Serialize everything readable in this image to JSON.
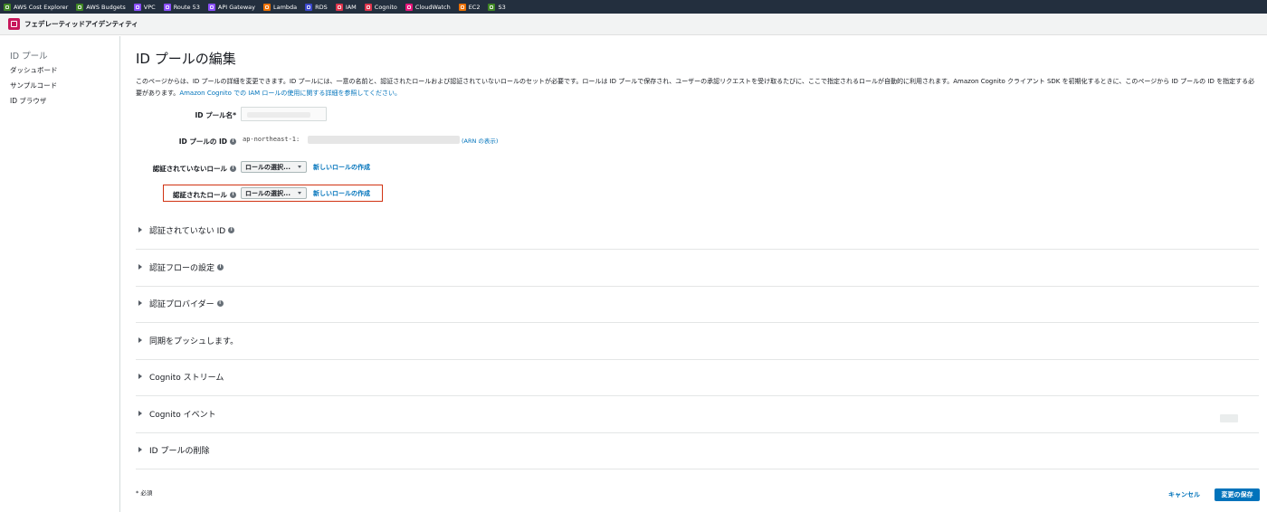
{
  "favorites": [
    {
      "label": "AWS Cost Explorer",
      "icon": "cost-explorer-icon",
      "color": "#3f8624"
    },
    {
      "label": "AWS Budgets",
      "icon": "budgets-icon",
      "color": "#3f8624"
    },
    {
      "label": "VPC",
      "icon": "vpc-icon",
      "color": "#8c4fff"
    },
    {
      "label": "Route 53",
      "icon": "route53-icon",
      "color": "#8c4fff"
    },
    {
      "label": "API Gateway",
      "icon": "api-gateway-icon",
      "color": "#8c4fff"
    },
    {
      "label": "Lambda",
      "icon": "lambda-icon",
      "color": "#ed7100"
    },
    {
      "label": "RDS",
      "icon": "rds-icon",
      "color": "#3b48cc"
    },
    {
      "label": "IAM",
      "icon": "iam-icon",
      "color": "#dd344c"
    },
    {
      "label": "Cognito",
      "icon": "cognito-icon",
      "color": "#dd344c"
    },
    {
      "label": "CloudWatch",
      "icon": "cloudwatch-icon",
      "color": "#e7157b"
    },
    {
      "label": "EC2",
      "icon": "ec2-icon",
      "color": "#ed7100"
    },
    {
      "label": "S3",
      "icon": "s3-icon",
      "color": "#3f8624"
    }
  ],
  "service": {
    "title": "フェデレーティッドアイデンティティ",
    "logo_color": "#c7175b"
  },
  "sidebar": {
    "title": "ID プール",
    "items": [
      {
        "label": "ダッシュボード"
      },
      {
        "label": "サンプルコード"
      },
      {
        "label": "ID ブラウザ"
      }
    ]
  },
  "main": {
    "title": "ID プールの編集",
    "description": "このページからは、ID プールの詳細を変更できます。ID プールには、一意の名前と、認証されたロールおよび認証されていないロールのセットが必要です。ロールは ID プールで保存され、ユーザーの承認リクエストを受け取るたびに、ここで指定されるロールが自動的に利用されます。Amazon Cognito クライアント SDK を初期化するときに、このページから ID プールの ID を指定する必要があります。",
    "description_link": "Amazon Cognito での IAM ロールの使用に関する詳細を参照してください。",
    "fields": {
      "pool_name_label": "ID プール名*",
      "pool_id_label": "ID プールの ID",
      "pool_id_value": "ap-northeast-1:",
      "arn_link": "(ARN の表示)",
      "unauth_role_label": "認証されていないロール",
      "auth_role_label": "認証されたロール",
      "role_select_placeholder": "ロールの選択...",
      "new_role_link": "新しいロールの作成"
    },
    "sections": [
      {
        "title": "認証されていない ID",
        "info": true
      },
      {
        "title": "認証フローの設定",
        "info": true
      },
      {
        "title": "認証プロバイダー",
        "info": true
      },
      {
        "title": "同期をプッシュします。",
        "info": false
      },
      {
        "title": "Cognito ストリーム",
        "info": false
      },
      {
        "title": "Cognito イベント",
        "info": false
      },
      {
        "title": "ID プールの削除",
        "info": false
      }
    ],
    "required_note": "* 必須",
    "cancel_label": "キャンセル",
    "save_label": "変更の保存"
  },
  "colors": {
    "link": "#0073bb",
    "primary_button": "#0073bb",
    "highlight_border": "#d13212",
    "top_bar": "#232f3e"
  }
}
